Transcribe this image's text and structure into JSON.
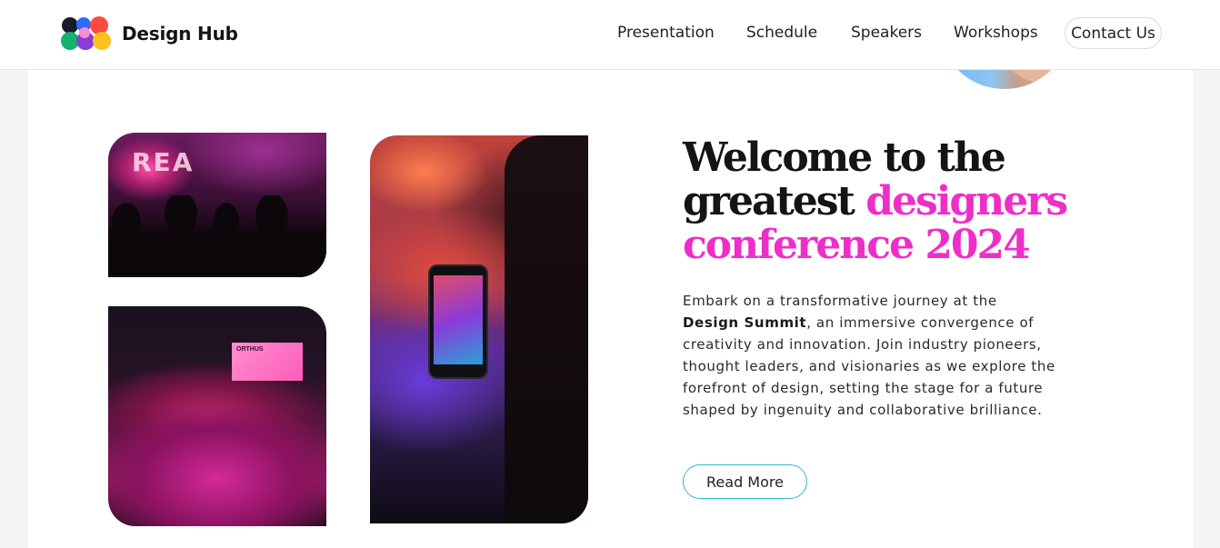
{
  "brand": {
    "logo_icon": "multicolor-blob-logo",
    "name": "Design Hub"
  },
  "nav": {
    "items": [
      "Presentation",
      "Schedule",
      "Speakers",
      "Workshops"
    ],
    "contact_label": "Contact Us"
  },
  "hero": {
    "title_line1": "Welcome to the",
    "title_line2_plain": "greatest ",
    "title_line2_accent": "designers",
    "title_line3_accent": "conference 2024",
    "desc_intro": "Embark on a transformative journey at the",
    "desc_bold": "Design Summit",
    "desc_rest": ", an immersive convergence of creativity and innovation. Join industry pioneers, thought leaders, and visionaries as we explore the forefront of design, setting the stage for a future shaped by ingenuity and collaborative brilliance.",
    "read_more_label": "Read More"
  },
  "photos": {
    "stage_text": "REA",
    "screen_text": "ORTHUS"
  },
  "colors": {
    "accent": "#ee2ec8",
    "button_border": "#37b6d2"
  }
}
